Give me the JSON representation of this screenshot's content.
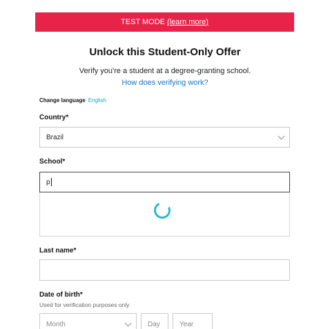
{
  "banner": {
    "mode_text": "TEST MODE",
    "learn_more": "(learn more)",
    "color": "#e8234a"
  },
  "header": {
    "title": "Unlock this Student-Only Offer",
    "subtitle": "Verify you're a student at a degree-granting school.",
    "help_link": "How does verifying work?"
  },
  "language": {
    "label": "Change language",
    "value": "English"
  },
  "form": {
    "country": {
      "label": "Country*",
      "value": "Brazil",
      "icon": "chevron-down-icon"
    },
    "school": {
      "label": "School*",
      "value": "p",
      "dropdown_state": "loading",
      "spinner_color": "#29b8cf"
    },
    "last_name": {
      "label": "Last name*",
      "value": ""
    },
    "date_of_birth": {
      "label": "Date of birth*",
      "hint": "Used for verification purposes only",
      "month_placeholder": "Month",
      "day_placeholder": "Day",
      "year_placeholder": "Year"
    }
  }
}
